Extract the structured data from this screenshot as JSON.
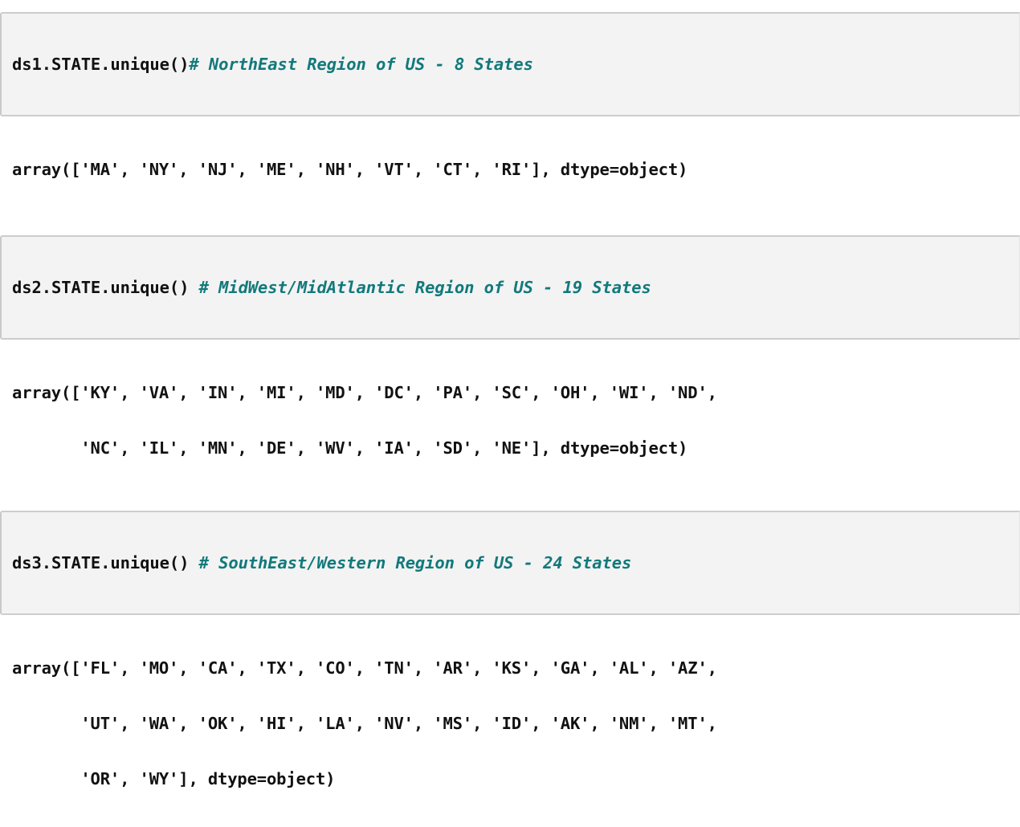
{
  "theme": {
    "page_background": "#ffffff",
    "input_cell_background": "#f3f3f3",
    "input_cell_border": "#cdcdcd",
    "code_color": "#111111",
    "comment_color": "#12797b"
  },
  "cells": [
    {
      "input": {
        "code": "ds1.STATE.unique()",
        "comment": "# NorthEast Region of US - 8 States"
      },
      "output": {
        "lines": [
          "array(['MA', 'NY', 'NJ', 'ME', 'NH', 'VT', 'CT', 'RI'], dtype=object)"
        ],
        "values": [
          "MA",
          "NY",
          "NJ",
          "ME",
          "NH",
          "VT",
          "CT",
          "RI"
        ],
        "dtype": "object"
      }
    },
    {
      "input": {
        "code": "ds2.STATE.unique() ",
        "comment": "# MidWest/MidAtlantic Region of US - 19 States"
      },
      "output": {
        "lines": [
          "array(['KY', 'VA', 'IN', 'MI', 'MD', 'DC', 'PA', 'SC', 'OH', 'WI', 'ND',",
          "       'NC', 'IL', 'MN', 'DE', 'WV', 'IA', 'SD', 'NE'], dtype=object)"
        ],
        "values": [
          "KY",
          "VA",
          "IN",
          "MI",
          "MD",
          "DC",
          "PA",
          "SC",
          "OH",
          "WI",
          "ND",
          "NC",
          "IL",
          "MN",
          "DE",
          "WV",
          "IA",
          "SD",
          "NE"
        ],
        "dtype": "object"
      }
    },
    {
      "input": {
        "code": "ds3.STATE.unique() ",
        "comment": "# SouthEast/Western Region of US - 24 States"
      },
      "output": {
        "lines": [
          "array(['FL', 'MO', 'CA', 'TX', 'CO', 'TN', 'AR', 'KS', 'GA', 'AL', 'AZ',",
          "       'UT', 'WA', 'OK', 'HI', 'LA', 'NV', 'MS', 'ID', 'AK', 'NM', 'MT',",
          "       'OR', 'WY'], dtype=object)"
        ],
        "values": [
          "FL",
          "MO",
          "CA",
          "TX",
          "CO",
          "TN",
          "AR",
          "KS",
          "GA",
          "AL",
          "AZ",
          "UT",
          "WA",
          "OK",
          "HI",
          "LA",
          "NV",
          "MS",
          "ID",
          "AK",
          "NM",
          "MT",
          "OR",
          "WY"
        ],
        "dtype": "object"
      }
    }
  ]
}
